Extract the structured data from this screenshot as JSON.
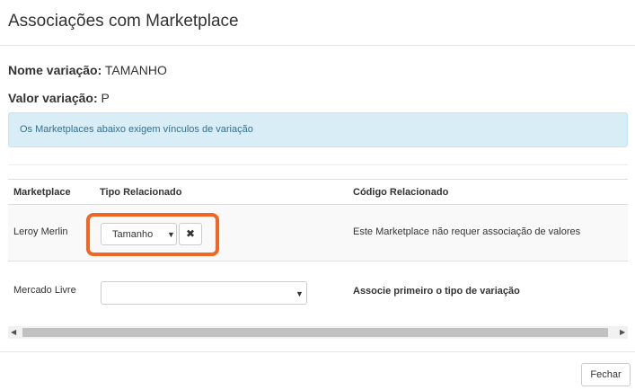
{
  "modal": {
    "title": "Associações com Marketplace"
  },
  "variation": {
    "name_label": "Nome variação:",
    "name_value": "TAMANHO",
    "value_label": "Valor variação:",
    "value_value": "P"
  },
  "alert": {
    "text": "Os Marketplaces abaixo exigem vínculos de variação"
  },
  "table": {
    "headers": [
      "Marketplace",
      "Tipo Relacionado",
      "Código Relacionado"
    ],
    "rows": [
      {
        "marketplace": "Leroy Merlin",
        "type_selected": "Tamanho",
        "code_text": "Este Marketplace não requer associação de valores"
      },
      {
        "marketplace": "Mercado Livre",
        "type_selected": "",
        "code_text": "Associe primeiro o tipo de variação"
      }
    ]
  },
  "icons": {
    "remove": "close-icon",
    "dropdown": "caret-down-icon"
  },
  "colors": {
    "highlight": "#f26522",
    "alert_bg": "#d9edf7",
    "alert_text": "#31708f"
  },
  "footer": {
    "close_label": "Fechar"
  }
}
